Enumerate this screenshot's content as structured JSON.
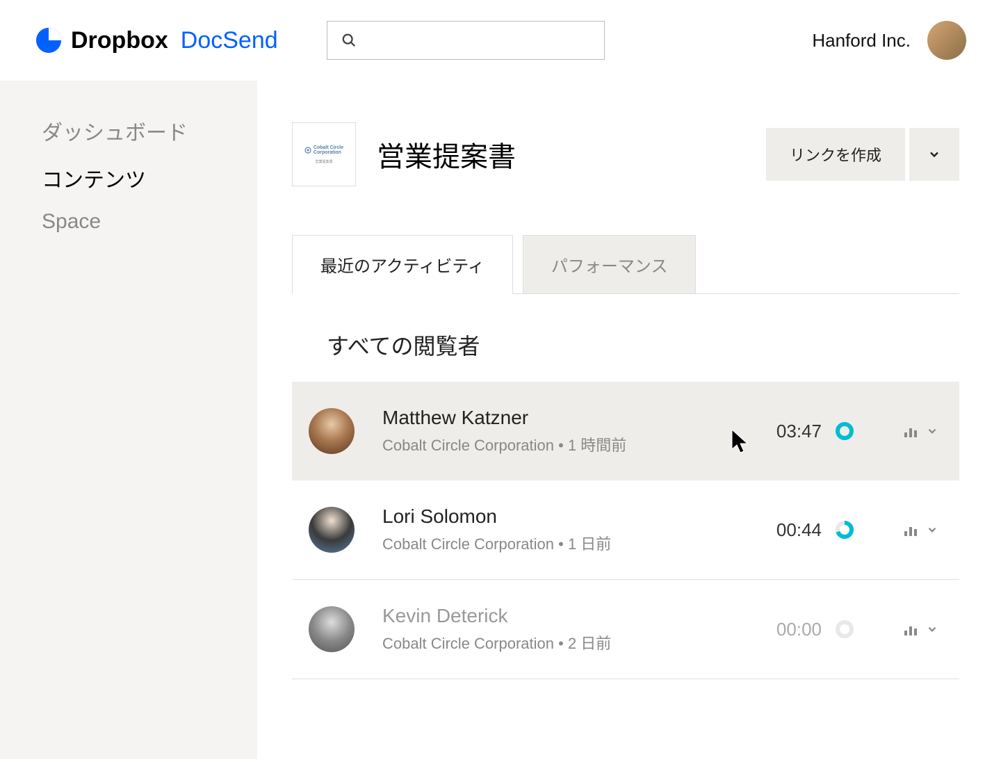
{
  "header": {
    "brand_primary": "Dropbox",
    "brand_secondary": "DocSend",
    "org_name": "Hanford Inc."
  },
  "sidebar": {
    "items": [
      {
        "label": "ダッシュボード",
        "active": false
      },
      {
        "label": "コンテンツ",
        "active": true
      },
      {
        "label": "Space",
        "active": false
      }
    ]
  },
  "document": {
    "title": "営業提案書",
    "thumb_line1": "Cobalt Circle",
    "thumb_line2": "Corporation",
    "create_link_label": "リンクを作成"
  },
  "tabs": [
    {
      "label": "最近のアクティビティ",
      "active": true
    },
    {
      "label": "パフォーマンス",
      "active": false
    }
  ],
  "viewers": {
    "section_title": "すべての閲覧者",
    "rows": [
      {
        "name": "Matthew Katzner",
        "company": "Cobalt Circle Corporation",
        "time_ago": "1 時間前",
        "duration": "03:47",
        "progress": 1.0,
        "highlighted": true,
        "dim": false
      },
      {
        "name": "Lori Solomon",
        "company": "Cobalt Circle Corporation",
        "time_ago": "1 日前",
        "duration": "00:44",
        "progress": 0.7,
        "highlighted": false,
        "dim": false
      },
      {
        "name": "Kevin Deterick",
        "company": "Cobalt Circle Corporation",
        "time_ago": "2 日前",
        "duration": "00:00",
        "progress": 0.0,
        "highlighted": false,
        "dim": true
      }
    ]
  }
}
